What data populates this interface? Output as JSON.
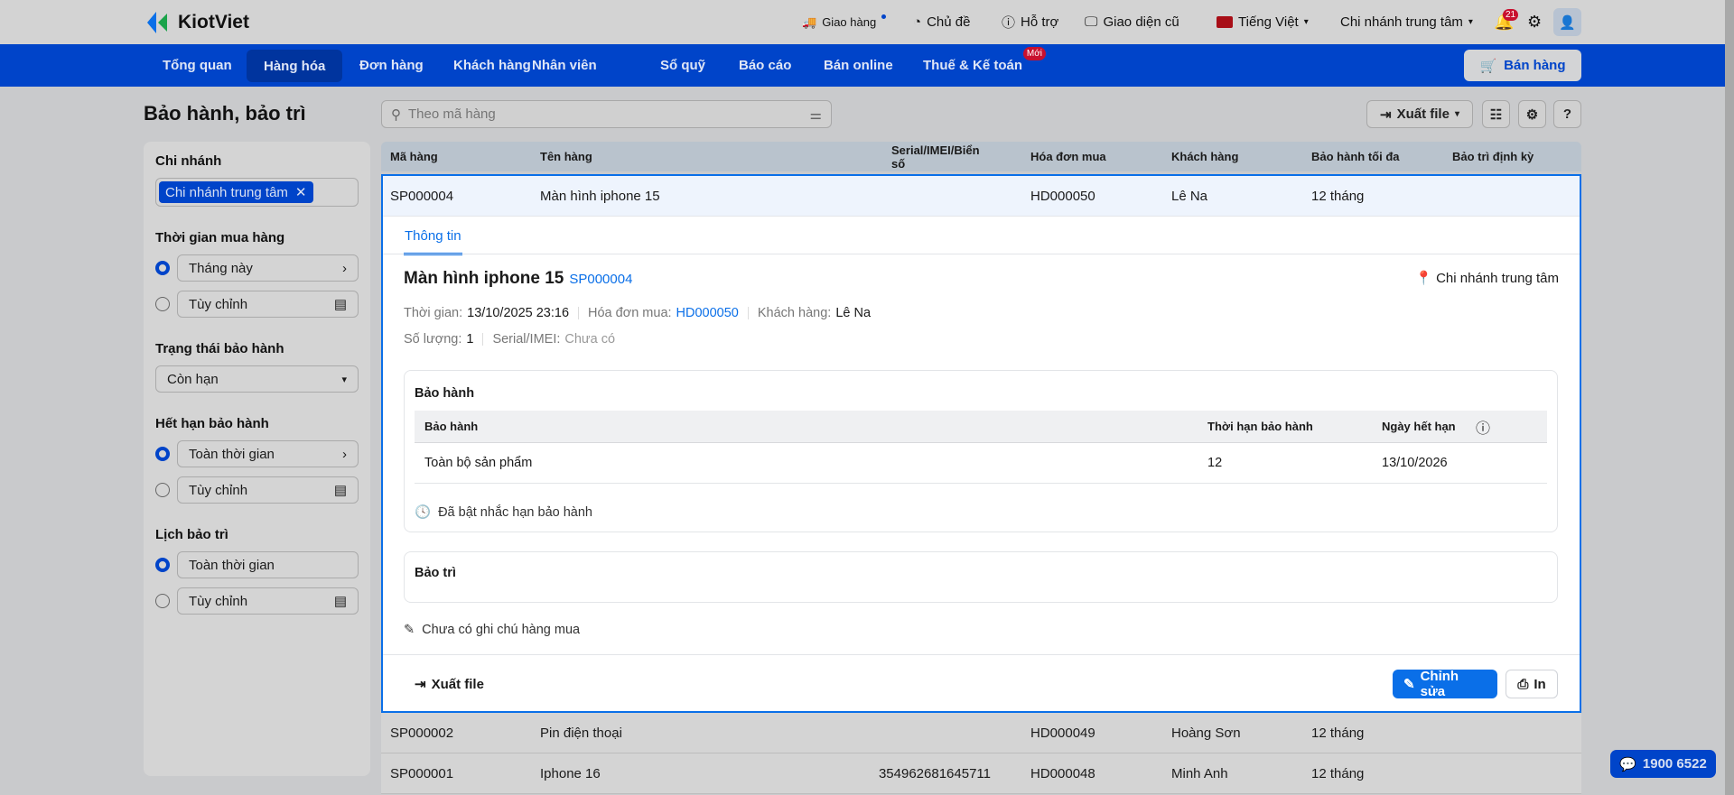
{
  "brand": {
    "name": "KiotViet",
    "accent": "#0044c9",
    "link": "#0a6fe8"
  },
  "topbar": {
    "delivery": "Giao hàng",
    "theme": "Chủ đề",
    "support": "Hỗ trợ",
    "old_ui": "Giao diện cũ",
    "language": "Tiếng Việt",
    "branch": "Chi nhánh trung tâm",
    "notifications": "21"
  },
  "nav": {
    "items": [
      "Tổng quan",
      "Hàng hóa",
      "Đơn hàng",
      "Khách hàng",
      "Nhân viên",
      "Sổ quỹ",
      "Báo cáo",
      "Bán online",
      "Thuế & Kế toán"
    ],
    "active": "Hàng hóa",
    "new_badge": "Mới",
    "sell_button": "Bán hàng"
  },
  "page": {
    "title": "Bảo hành, bảo trì",
    "search_placeholder": "Theo mã hàng",
    "export": "Xuất file"
  },
  "filters": {
    "branch_label": "Chi nhánh",
    "branch_tag": "Chi nhánh trung tâm",
    "purchase_time_label": "Thời gian mua hàng",
    "purchase_time_preset": "Tháng này",
    "purchase_time_custom": "Tùy chỉnh",
    "status_label": "Trạng thái bảo hành",
    "status_value": "Còn hạn",
    "expiry_label": "Hết hạn bảo hành",
    "expiry_preset": "Toàn thời gian",
    "expiry_custom": "Tùy chỉnh",
    "maintenance_label": "Lịch bảo trì",
    "maintenance_preset": "Toàn thời gian",
    "maintenance_custom": "Tùy chỉnh"
  },
  "table": {
    "columns": [
      "Mã hàng",
      "Tên hàng",
      "Serial/IMEI/Biển số",
      "Hóa đơn mua",
      "Khách hàng",
      "Bảo hành tối đa",
      "Bảo trì định kỳ"
    ],
    "rows": [
      {
        "code": "SP000004",
        "name": "Màn hình iphone 15",
        "serial": "",
        "invoice": "HD000050",
        "customer": "Lê Na",
        "warranty": "12 tháng",
        "maintenance": ""
      },
      {
        "code": "SP000002",
        "name": "Pin điện thoại",
        "serial": "",
        "invoice": "HD000049",
        "customer": "Hoàng Sơn",
        "warranty": "12 tháng",
        "maintenance": ""
      },
      {
        "code": "SP000001",
        "name": "Iphone 16",
        "serial": "354962681645711",
        "invoice": "HD000048",
        "customer": "Minh Anh",
        "warranty": "12 tháng",
        "maintenance": ""
      }
    ]
  },
  "detail": {
    "tab": "Thông tin",
    "title": "Màn hình iphone 15",
    "code": "SP000004",
    "branch": "Chi nhánh trung tâm",
    "time_label": "Thời gian:",
    "time": "13/10/2025 23:16",
    "invoice_label": "Hóa đơn mua:",
    "invoice": "HD000050",
    "customer_label": "Khách hàng:",
    "customer": "Lê Na",
    "qty_label": "Số lượng:",
    "qty": "1",
    "serial_label": "Serial/IMEI:",
    "serial": "Chưa có",
    "warranty_title": "Bảo hành",
    "warranty_cols": [
      "Bảo hành",
      "Thời hạn bảo hành",
      "Ngày hết hạn"
    ],
    "warranty_row": {
      "scope": "Toàn bộ sản phẩm",
      "term": "12",
      "expiry": "13/10/2026"
    },
    "reminder": "Đã bật nhắc hạn bảo hành",
    "maintenance_title": "Bảo trì",
    "note": "Chưa có ghi chú hàng mua",
    "export": "Xuất file",
    "edit": "Chỉnh sửa",
    "print": "In"
  },
  "hotline": "1900 6522"
}
